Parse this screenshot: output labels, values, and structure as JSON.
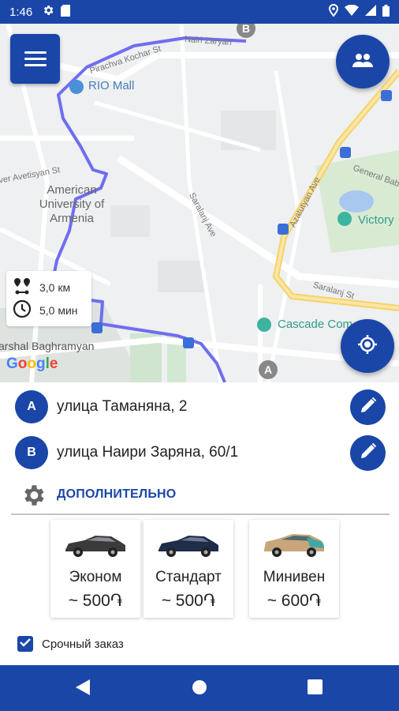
{
  "status_bar": {
    "time": "1:46",
    "icons_left": [
      "gear-icon",
      "sim-card-icon"
    ],
    "icons_right": [
      "location-icon",
      "wifi-icon",
      "signal-icon",
      "battery-icon"
    ]
  },
  "map": {
    "labels": {
      "nairi_zaryan": "Nairi Zaryan",
      "pirachva": "Pirachva Kochar St",
      "rio_mall": "RIO Mall",
      "avetisyan": "ver Avetisyan St",
      "american_university": "American University of Armenia",
      "saralanj_ave": "Saralanj Ave",
      "azatutyan_ave": "Azatutyan Ave",
      "general_baba": "General Baba",
      "victory": "Victory",
      "saralanj_st": "Saralanj St",
      "cascade": "Cascade Com",
      "baghramyan": "arshal Baghramyan"
    },
    "markers": {
      "a": "A",
      "b": "B"
    },
    "route_color": "#6f6df0",
    "google": "Google"
  },
  "route_info": {
    "distance": "3,0 км",
    "duration": "5,0 мин"
  },
  "addresses": {
    "from_badge": "A",
    "from": "улица Таманяна, 2",
    "to_badge": "B",
    "to": "улица Наири Заряна, 60/1"
  },
  "extra": {
    "label": "ДОПОЛНИТЕЛЬНО"
  },
  "tariffs": [
    {
      "name": "Эконом",
      "price": "~ 500֏",
      "car_color": "#3b3b3b"
    },
    {
      "name": "Стандарт",
      "price": "~ 500֏",
      "car_color": "#1f2c4a"
    },
    {
      "name": "Минивен",
      "price": "~ 600֏",
      "car_color": "#c8a57a"
    }
  ],
  "urgent": {
    "label": "Срочный заказ",
    "checked": true
  },
  "colors": {
    "primary": "#1a46a8",
    "map_bg": "#eef0f1",
    "route": "#6f6df0"
  }
}
